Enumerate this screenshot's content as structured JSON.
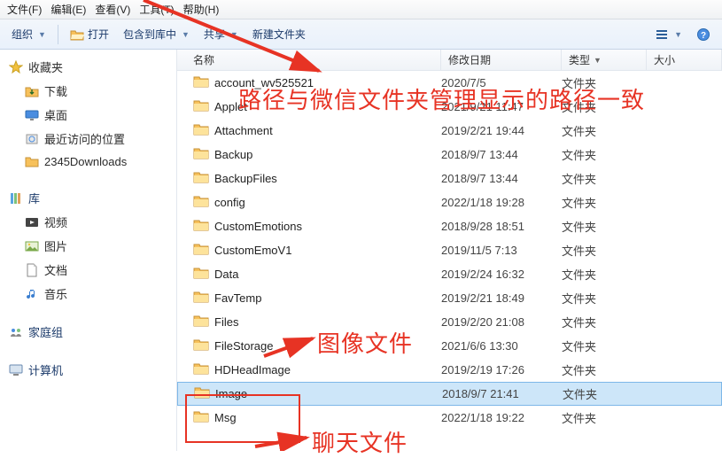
{
  "menu": {
    "file": "文件(F)",
    "edit": "编辑(E)",
    "view": "查看(V)",
    "tools": "工具(T)",
    "help": "帮助(H)"
  },
  "toolbar": {
    "organize": "组织",
    "open": "打开",
    "include": "包含到库中",
    "share": "共享",
    "new_folder": "新建文件夹"
  },
  "sidebar": {
    "favorites": "收藏夹",
    "downloads": "下载",
    "desktop": "桌面",
    "recent": "最近访问的位置",
    "dl2345": "2345Downloads",
    "libraries": "库",
    "videos": "视频",
    "pictures": "图片",
    "documents": "文档",
    "music": "音乐",
    "homegroup": "家庭组",
    "computer": "计算机"
  },
  "columns": {
    "name": "名称",
    "date": "修改日期",
    "type": "类型",
    "size": "大小"
  },
  "type_folder": "文件夹",
  "rows": [
    {
      "name": "account_wv525521",
      "date": "2020/7/5",
      "selected": false
    },
    {
      "name": "Applet",
      "date": "2021/9/21 11:47",
      "selected": false
    },
    {
      "name": "Attachment",
      "date": "2019/2/21 19:44",
      "selected": false
    },
    {
      "name": "Backup",
      "date": "2018/9/7 13:44",
      "selected": false
    },
    {
      "name": "BackupFiles",
      "date": "2018/9/7 13:44",
      "selected": false
    },
    {
      "name": "config",
      "date": "2022/1/18 19:28",
      "selected": false
    },
    {
      "name": "CustomEmotions",
      "date": "2018/9/28 18:51",
      "selected": false
    },
    {
      "name": "CustomEmoV1",
      "date": "2019/11/5 7:13",
      "selected": false
    },
    {
      "name": "Data",
      "date": "2019/2/24 16:32",
      "selected": false
    },
    {
      "name": "FavTemp",
      "date": "2019/2/21 18:49",
      "selected": false
    },
    {
      "name": "Files",
      "date": "2019/2/20 21:08",
      "selected": false
    },
    {
      "name": "FileStorage",
      "date": "2021/6/6 13:30",
      "selected": false
    },
    {
      "name": "HDHeadImage",
      "date": "2019/2/19 17:26",
      "selected": false
    },
    {
      "name": "Image",
      "date": "2018/9/7 21:41",
      "selected": true
    },
    {
      "name": "Msg",
      "date": "2022/1/18 19:22",
      "selected": false
    }
  ],
  "annotations": {
    "path_match": "路径与微信文件夹管理显示的路径一致",
    "image_file": "图像文件",
    "chat_file": "聊天文件"
  }
}
